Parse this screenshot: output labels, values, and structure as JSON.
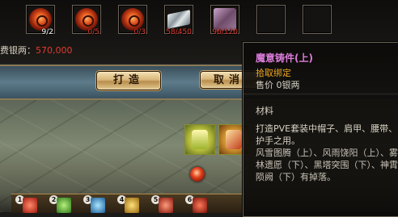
{
  "colors": {
    "item_name": "#dc7ddc",
    "bind": "#f0a820",
    "count_ok": "#ffffff",
    "count_short": "#e03a2e",
    "silver_value": "#e23b2c"
  },
  "materials": [
    {
      "icon": "fire-orb-icon",
      "count": "9/2",
      "state": "ok"
    },
    {
      "icon": "fire-orb-icon",
      "count": "0/5",
      "state": "short"
    },
    {
      "icon": "fire-orb-icon",
      "count": "0/3",
      "state": "short"
    },
    {
      "icon": "silver-bar-icon",
      "count": "58/450",
      "state": "short"
    },
    {
      "icon": "material-box-icon",
      "count": "96/120",
      "state": "short"
    },
    {
      "icon": "empty-slot",
      "count": "",
      "state": "empty"
    },
    {
      "icon": "empty-slot",
      "count": "",
      "state": "empty"
    }
  ],
  "silver_cost": {
    "label": "费银两：",
    "value": "570,000"
  },
  "buttons": {
    "craft": "打造",
    "cancel": "取消"
  },
  "tooltip": {
    "name": "魔意铸件(上)",
    "bind": "拾取绑定",
    "price": "售价 0银两",
    "type": "材料",
    "desc": "打造PVE套装中帽子、肩甲、腰带、护手之用。",
    "sets": "风雪图腾（上）、风雨饶阳（上）、雾林遗愿（下）、黑塔突围（下）、神霄陨阙（下）有掉落。"
  },
  "hotbar": [
    {
      "key": "1",
      "icon": "red-skill-icon"
    },
    {
      "key": "2",
      "icon": "green-skill-icon"
    },
    {
      "key": "3",
      "icon": "blue-skill-icon"
    },
    {
      "key": "4",
      "icon": "yellow-skill-icon"
    },
    {
      "key": "5",
      "icon": "red-skill-icon"
    },
    {
      "key": "6",
      "icon": "red-skill-icon"
    }
  ]
}
